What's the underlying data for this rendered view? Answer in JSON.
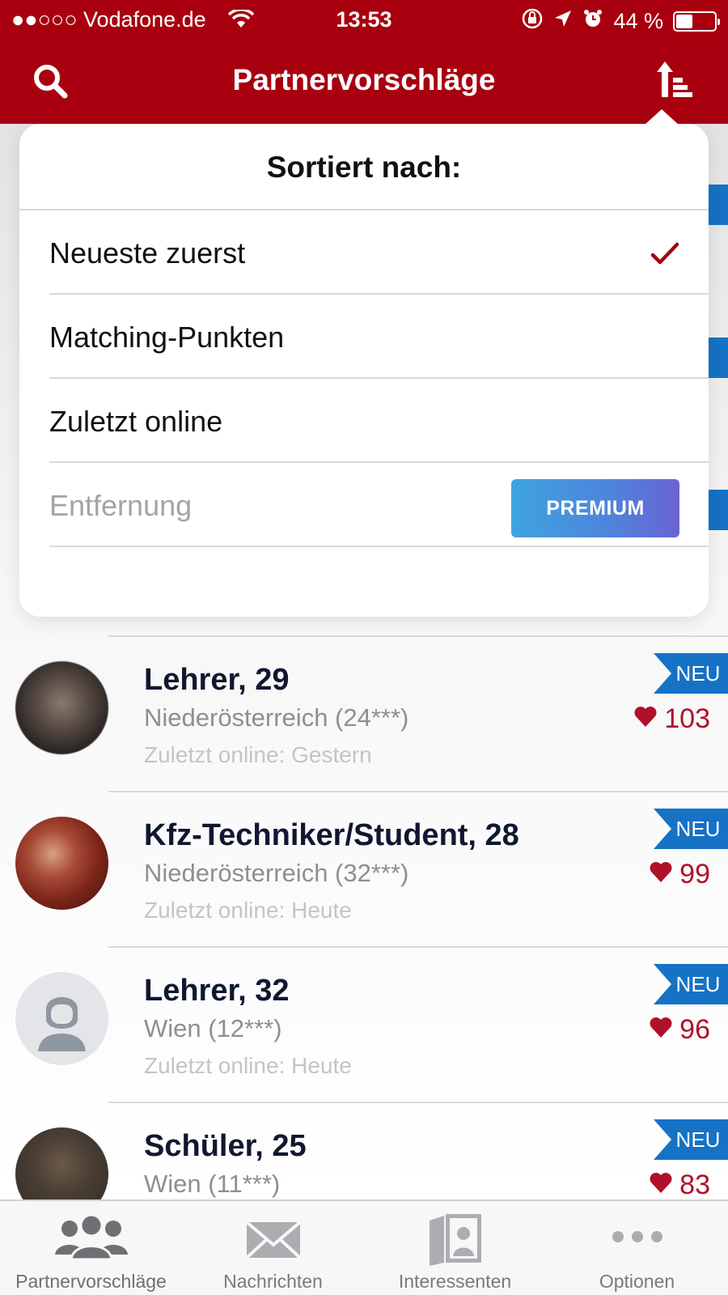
{
  "colors": {
    "brand": "#a8000f",
    "accent_blue": "#1672c5",
    "heart": "#b0102a",
    "check": "#a8000f"
  },
  "status_bar": {
    "carrier": "●●○○○ Vodafone.de",
    "time": "13:53",
    "battery": "44 %",
    "battery_level": 0.44,
    "icons": [
      "wifi-icon",
      "rotation-lock-icon",
      "location-arrow-icon",
      "alarm-icon",
      "battery-icon"
    ]
  },
  "header": {
    "title": "Partnervorschläge",
    "left_icon": "search-icon",
    "right_icon": "sort-icon"
  },
  "sort_menu": {
    "title": "Sortiert nach:",
    "options": [
      {
        "label": "Neueste zuerst",
        "selected": true
      },
      {
        "label": "Matching-Punkten",
        "selected": false
      },
      {
        "label": "Zuletzt online",
        "selected": false
      },
      {
        "label": "Entfernung",
        "selected": false,
        "disabled": true,
        "badge": "PREMIUM"
      }
    ]
  },
  "profiles": [
    {
      "name": "Lehrer, 29",
      "location": "Niederösterreich (24***)",
      "last_online": "Zuletzt online: Gestern",
      "badge": "NEU",
      "points": "103",
      "avatar": "photo-blurred"
    },
    {
      "name": "Kfz-Techniker/Student, 28",
      "location": "Niederösterreich (32***)",
      "last_online": "Zuletzt online: Heute",
      "badge": "NEU",
      "points": "99",
      "avatar": "photo-blurred"
    },
    {
      "name": "Lehrer, 32",
      "location": "Wien (12***)",
      "last_online": "Zuletzt online: Heute",
      "badge": "NEU",
      "points": "96",
      "avatar": "placeholder-person-icon"
    },
    {
      "name": "Schüler, 25",
      "location": "Wien (11***)",
      "last_online": "",
      "badge": "NEU",
      "points": "83",
      "avatar": "photo-blurred"
    }
  ],
  "tabs": [
    {
      "label": "Partnervorschläge",
      "icon": "people-icon",
      "active": true
    },
    {
      "label": "Nachrichten",
      "icon": "envelope-icon",
      "active": false
    },
    {
      "label": "Interessenten",
      "icon": "profile-cards-icon",
      "active": false
    },
    {
      "label": "Optionen",
      "icon": "more-dots-icon",
      "active": false
    }
  ]
}
